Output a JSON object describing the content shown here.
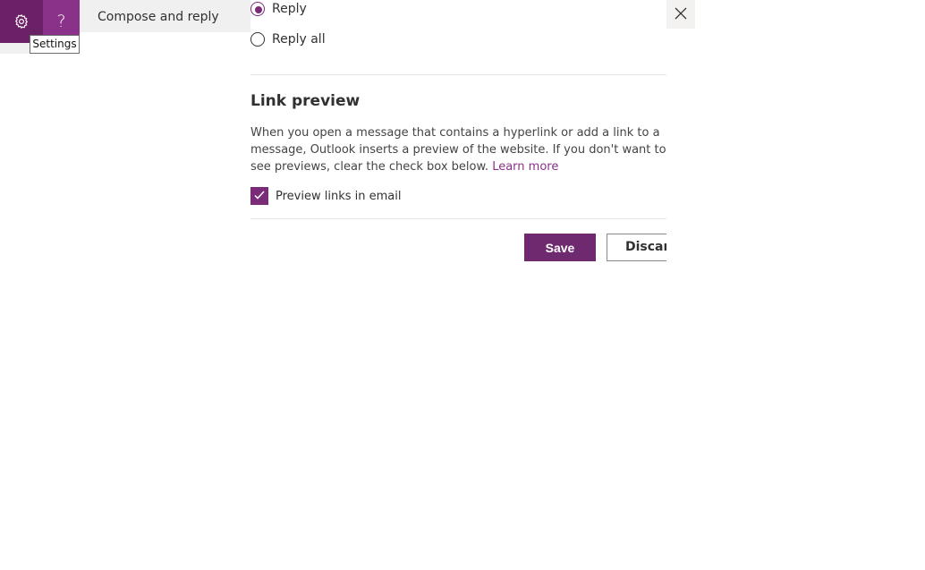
{
  "iconbar": {
    "settings_icon": "gear-icon",
    "help_icon": "question-icon",
    "help_glyph": "?"
  },
  "tooltip": {
    "text": "Settings"
  },
  "nav": {
    "selected_item": "Compose and reply"
  },
  "reply_options": [
    {
      "label": "Reply",
      "selected": true
    },
    {
      "label": "Reply all",
      "selected": false
    }
  ],
  "link_preview": {
    "title": "Link preview",
    "description": "When you open a message that contains a hyperlink or add a link to a message, Outlook inserts a preview of the website. If you don't want to see previews, clear the check box below.",
    "learn_more": "Learn more",
    "checkbox_label": "Preview links in email",
    "checkbox_checked": true
  },
  "actions": {
    "save": "Save",
    "discard": "Discard"
  },
  "colors": {
    "accent": "#7a2c78",
    "settings_tile": "#6b2166",
    "help_tile": "#8a318a"
  }
}
